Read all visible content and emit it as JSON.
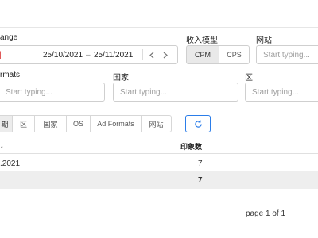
{
  "filters": {
    "date_range_label": "ange",
    "date_start": "25/10/2021",
    "date_end": "25/11/2021",
    "date_separator": "–",
    "revenue_model_label": "收入模型",
    "revenue_models": [
      "CPM",
      "CPS"
    ],
    "site_label": "网站",
    "site_placeholder": "Start typing...",
    "ad_formats_label": "rmats",
    "ad_formats_placeholder": "Start typing...",
    "country_label": "国家",
    "country_placeholder": "Start typing...",
    "region_label": "区",
    "region_placeholder": "Start typing..."
  },
  "group_tabs": [
    "期",
    "区",
    "国家",
    "OS",
    "Ad Formats",
    "网站"
  ],
  "table": {
    "col_date_sort_indicator": "↓",
    "col_impressions": "印象数",
    "rows": [
      {
        "date": ".2021",
        "impressions": "7"
      }
    ],
    "total": {
      "impressions": "7"
    }
  },
  "pagination": "page 1 of 1",
  "colors": {
    "accent": "#2b7de9"
  }
}
